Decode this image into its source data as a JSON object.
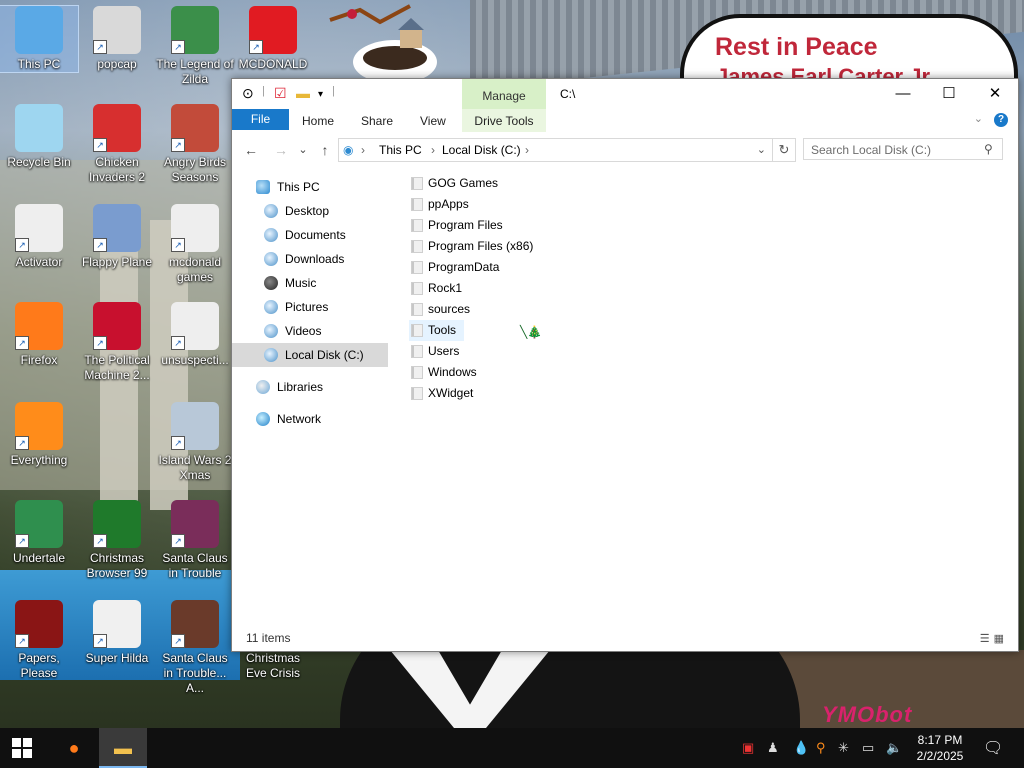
{
  "desktop": {
    "icons": [
      {
        "label": "This PC",
        "color": "#5aa9e6"
      },
      {
        "label": "popcap",
        "color": "#d9d9d9"
      },
      {
        "label": "The Legend of Zilda",
        "color": "#3b8f4a"
      },
      {
        "label": "MCDONALD",
        "color": "#e11b22"
      },
      {
        "label": "Recycle Bin",
        "color": "#9ed6f0"
      },
      {
        "label": "Chicken Invaders 2",
        "color": "#d72f2f"
      },
      {
        "label": "Angry Birds Seasons",
        "color": "#c24b3a"
      },
      {
        "label": "Activator",
        "color": "#eeeeee"
      },
      {
        "label": "Flappy Plane",
        "color": "#7a9ccf"
      },
      {
        "label": "mcdonald games",
        "color": "#eeeeee"
      },
      {
        "label": "Firefox",
        "color": "#ff7a1a"
      },
      {
        "label": "The Political Machine 2...",
        "color": "#c8102e"
      },
      {
        "label": "unsuspecti...",
        "color": "#eeeeee"
      },
      {
        "label": "Everything",
        "color": "#ff8c1a"
      },
      {
        "label": "Island Wars 2 Xmas",
        "color": "#b8c8d8"
      },
      {
        "label": "Undertale",
        "color": "#2f8f4e"
      },
      {
        "label": "Christmas Browser 99",
        "color": "#1f7a2b"
      },
      {
        "label": "Santa Claus in Trouble",
        "color": "#7a2d5a"
      },
      {
        "label": "Papers, Please",
        "color": "#8a1515"
      },
      {
        "label": "Super Hilda",
        "color": "#f0f0f0"
      },
      {
        "label": "Santa Claus in Trouble... A...",
        "color": "#6a3a2a"
      },
      {
        "label": "Christmas Eve Crisis",
        "color": "#333333"
      }
    ],
    "sign_line1": "Rest in Peace",
    "sign_line2": "James Earl Carter Jr",
    "signature": "YMObot"
  },
  "explorer": {
    "title_path": "C:\\",
    "manage_tab": "Manage",
    "ribbon_tabs": [
      "File",
      "Home",
      "Share",
      "View",
      "Drive Tools"
    ],
    "breadcrumb": [
      "This PC",
      "Local Disk (C:)"
    ],
    "search_placeholder": "Search Local Disk (C:)",
    "nav": [
      {
        "label": "This PC",
        "icon": "pc"
      },
      {
        "label": "Desktop",
        "icon": "blue"
      },
      {
        "label": "Documents",
        "icon": "blue"
      },
      {
        "label": "Downloads",
        "icon": "blue"
      },
      {
        "label": "Music",
        "icon": "dark"
      },
      {
        "label": "Pictures",
        "icon": "blue"
      },
      {
        "label": "Videos",
        "icon": "blue"
      },
      {
        "label": "Local Disk (C:)",
        "icon": "blue"
      },
      {
        "label": "Libraries",
        "icon": "lib"
      },
      {
        "label": "Network",
        "icon": "net"
      }
    ],
    "files": [
      "GOG Games",
      "ppApps",
      "Program Files",
      "Program Files (x86)",
      "ProgramData",
      "Rock1",
      "sources",
      "Tools",
      "Users",
      "Windows",
      "XWidget"
    ],
    "status": "11 items"
  },
  "taskbar": {
    "time": "8:17 PM",
    "date": "2/2/2025"
  },
  "colors": {
    "accent": "#1979ca",
    "manage_bg": "#d8f0c8",
    "taskbar": "#101010"
  }
}
